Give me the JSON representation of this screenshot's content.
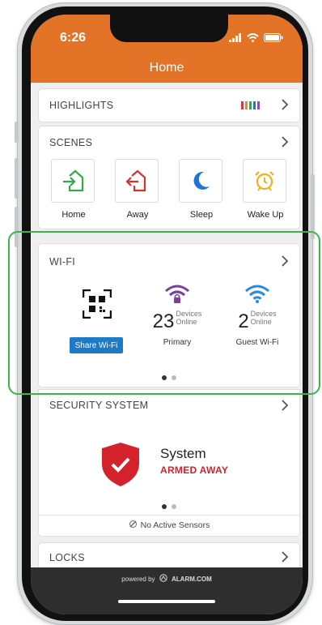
{
  "status_bar": {
    "time": "6:26"
  },
  "header": {
    "title": "Home",
    "color": "#e27327"
  },
  "highlights": {
    "title": "HIGHLIGHTS"
  },
  "scenes": {
    "title": "SCENES",
    "items": [
      {
        "label": "Home",
        "icon": "home-arrive-icon",
        "color": "#3aa54a"
      },
      {
        "label": "Away",
        "icon": "home-leave-icon",
        "color": "#d9322e"
      },
      {
        "label": "Sleep",
        "icon": "moon-icon",
        "color": "#1f74d6"
      },
      {
        "label": "Wake Up",
        "icon": "alarm-clock-icon",
        "color": "#f2b01e"
      }
    ]
  },
  "wifi": {
    "title": "WI-FI",
    "share_label": "Share Wi-Fi",
    "primary": {
      "count": "23",
      "unit1": "Devices",
      "unit2": "Online",
      "label": "Primary",
      "color": "#7b3fa0"
    },
    "guest": {
      "count": "2",
      "unit1": "Devices",
      "unit2": "Online",
      "label": "Guest Wi-Fi",
      "color": "#2a8ae0"
    }
  },
  "security": {
    "title": "SECURITY SYSTEM",
    "system_label": "System",
    "status": "ARMED AWAY",
    "status_color": "#d3222b",
    "sensors": "No Active Sensors"
  },
  "locks": {
    "title": "LOCKS"
  },
  "footer": {
    "powered": "powered by",
    "brand": "ALARM.COM"
  }
}
